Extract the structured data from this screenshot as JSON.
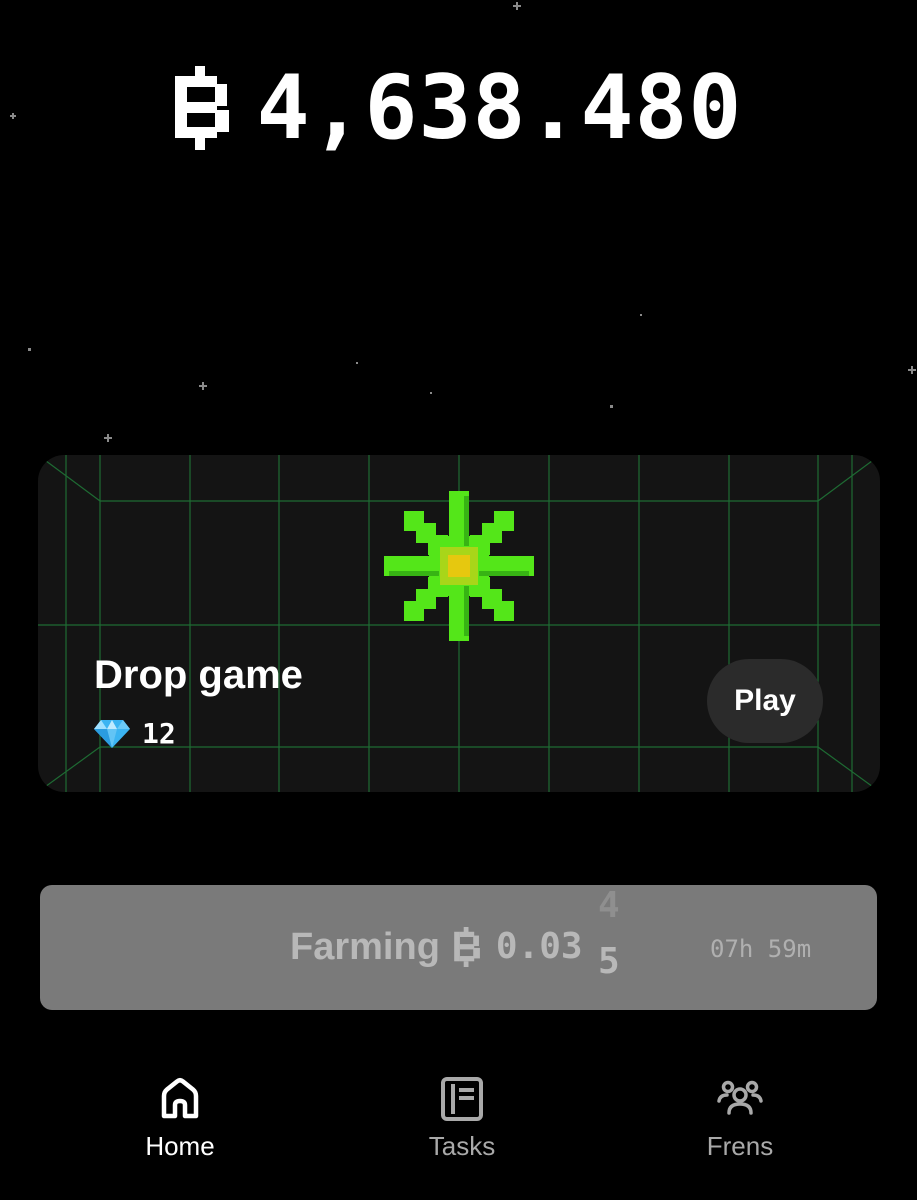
{
  "header": {
    "currency_icon": "blum-points-icon",
    "balance": "4,638.480"
  },
  "game_card": {
    "title": "Drop game",
    "tickets_icon": "diamond-icon",
    "tickets": "12",
    "play_label": "Play",
    "grid_color": "#1e6b33",
    "clover_color": "#54e619"
  },
  "farming": {
    "label": "Farming",
    "currency_icon": "blum-points-icon",
    "value": "0.03",
    "rolling_digit_next": "4",
    "rolling_digit_current": "5",
    "timer": "07h 59m"
  },
  "nav": {
    "items": [
      {
        "label": "Home",
        "icon": "home-icon",
        "active": true
      },
      {
        "label": "Tasks",
        "icon": "tasks-icon",
        "active": false
      },
      {
        "label": "Frens",
        "icon": "frens-icon",
        "active": false
      }
    ]
  },
  "colors": {
    "background": "#000000",
    "card": "#141414",
    "farming_bar": "#7a7a7a",
    "nav_active": "#ffffff",
    "nav_inactive": "#a9a9a9"
  }
}
